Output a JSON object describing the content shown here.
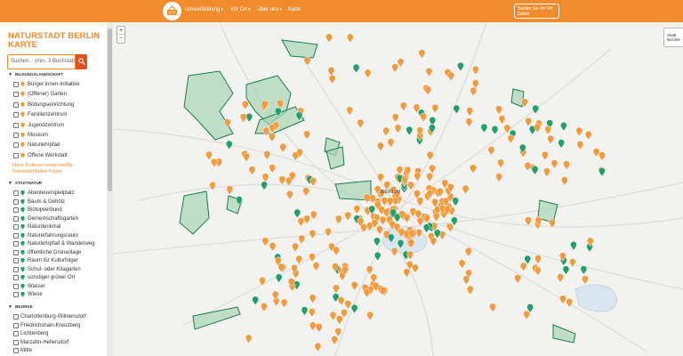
{
  "nav": {
    "items": [
      {
        "label": "Umweltbildung",
        "chevron": "▾"
      },
      {
        "label": "Vor Ort",
        "chevron": "▾"
      },
      {
        "label": "Über uns",
        "chevron": "▾"
      },
      {
        "label": "Karte",
        "chevron": ""
      }
    ],
    "cta_label": "Stellen Sie Ihr Ort Daten",
    "accent_color": "#f08c2e"
  },
  "sidebar": {
    "title": "NATURSTADT BERLIN KARTE",
    "search_placeholder": "Suchen... (min. 3 Buchstaben)",
    "sections": [
      {
        "heading": "BILDUNGSLANDSCHAFT",
        "items": [
          {
            "label": "Bürger:innen-Initiative",
            "marker": "orange"
          },
          {
            "label": "(Offener) Garten",
            "marker": "orange"
          },
          {
            "label": "Bildungseinrichtung",
            "marker": "orange"
          },
          {
            "label": "Familienzentrum",
            "marker": "orange"
          },
          {
            "label": "Jugendzentrum",
            "marker": "orange"
          },
          {
            "label": "Museum",
            "marker": "orange"
          },
          {
            "label": "Naturlehrpfad",
            "marker": "orange"
          },
          {
            "label": "Offene Werkstatt",
            "marker": "orange"
          }
        ],
        "links": [
          "Neue Referent:innen hierfür",
          "Naturlehrpfaden folgen"
        ]
      },
      {
        "heading": "STADTNATUR",
        "items": [
          {
            "label": "Abenteuerspielplatz",
            "marker": "green"
          },
          {
            "label": "Baum & Gehölz",
            "marker": "green"
          },
          {
            "label": "Biotopverbund",
            "marker": "green"
          },
          {
            "label": "Gemeinschaftsgarten",
            "marker": "green"
          },
          {
            "label": "Naturdenkmal",
            "marker": "green"
          },
          {
            "label": "Naturerfahrungsraum",
            "marker": "green"
          },
          {
            "label": "Naturlehrpfad & Wanderweg",
            "marker": "green"
          },
          {
            "label": "öffentliche Grünanlage",
            "marker": "green"
          },
          {
            "label": "Raum für Kulturfolger",
            "marker": "green"
          },
          {
            "label": "Schul- oder Kitagarten",
            "marker": "green"
          },
          {
            "label": "sonstiger grüner Ort",
            "marker": "green"
          },
          {
            "label": "Wasser",
            "marker": "green"
          },
          {
            "label": "Wiese",
            "marker": "green"
          }
        ]
      },
      {
        "heading": "BEZIRKE",
        "items": [
          {
            "label": "Charlottenburg-Wilmersdorf",
            "marker": "none"
          },
          {
            "label": "Friedrichshain-Kreuzberg",
            "marker": "none"
          },
          {
            "label": "Lichtenberg",
            "marker": "none"
          },
          {
            "label": "Marzahn-Hellersdorf",
            "marker": "none"
          },
          {
            "label": "Mitte",
            "marker": "none"
          }
        ]
      }
    ]
  },
  "map": {
    "zoom_in": "+",
    "zoom_out": "−",
    "layer_control": "Stadt Bezirke",
    "city_label": "BERLIN",
    "colors": {
      "orange_marker": "#f39a3a",
      "green_marker": "#22a06b",
      "area_fill": "#a8d5b5",
      "area_stroke": "#1e7a4a"
    }
  }
}
